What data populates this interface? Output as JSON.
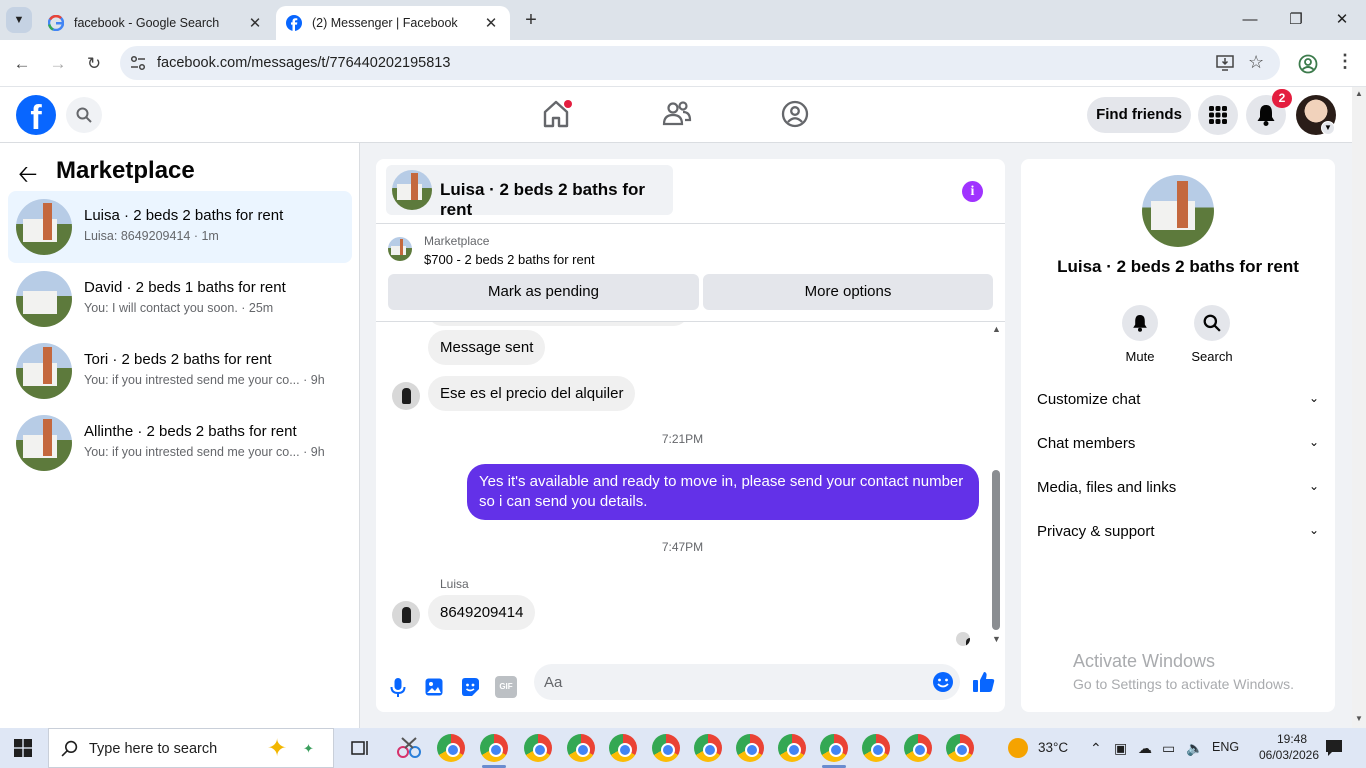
{
  "browser": {
    "tabs": [
      {
        "title": "facebook - Google Search",
        "icon": "google-icon",
        "active": false
      },
      {
        "title": "(2) Messenger | Facebook",
        "icon": "facebook-icon",
        "active": true
      }
    ],
    "url": "facebook.com/messages/t/776440202195813"
  },
  "header": {
    "find_friends": "Find friends",
    "notification_count": "2",
    "accent": "#0866ff"
  },
  "sidebar": {
    "title": "Marketplace",
    "conversations": [
      {
        "name": "Luisa · 2 beds 2 baths for rent",
        "preview": "Luisa: 8649209414 · 1m",
        "active": true
      },
      {
        "name": "David · 2 beds 1 baths for rent",
        "preview": "You: I will contact you soon. · 25m",
        "active": false
      },
      {
        "name": "Tori · 2 beds 2 baths for rent",
        "preview": "You: if you intrested send me your co... · 9h",
        "active": false
      },
      {
        "name": "Allinthe · 2 beds 2 baths for rent",
        "preview": "You: if you intrested send me your co... · 9h",
        "active": false
      }
    ]
  },
  "chat": {
    "title": "Luisa · 2 beds 2 baths for rent",
    "marketplace_label": "Marketplace",
    "listing": "$700 - 2 beds 2 baths for rent",
    "mark_pending": "Mark as pending",
    "more_options": "More options",
    "messages": {
      "m1": "Message sent",
      "m2": "Ese es el precio del alquiler",
      "t1": "7:21PM",
      "m3": "Yes it's available and ready to move in, please send your contact number so i can send you details.",
      "t2": "7:47PM",
      "sender": "Luisa",
      "m4": "8649209414"
    },
    "input_placeholder": "Aa",
    "outgoing_color": "#6331e8"
  },
  "info_panel": {
    "name": "Luisa · 2 beds 2 baths for rent",
    "mute": "Mute",
    "search": "Search",
    "rows": [
      "Customize chat",
      "Chat members",
      "Media, files and links",
      "Privacy & support"
    ],
    "activate_title": "Activate Windows",
    "activate_sub": "Go to Settings to activate Windows."
  },
  "taskbar": {
    "search_placeholder": "Type here to search",
    "temperature": "33°C",
    "language": "ENG",
    "time": "19:48",
    "date": "06/03/2026"
  }
}
